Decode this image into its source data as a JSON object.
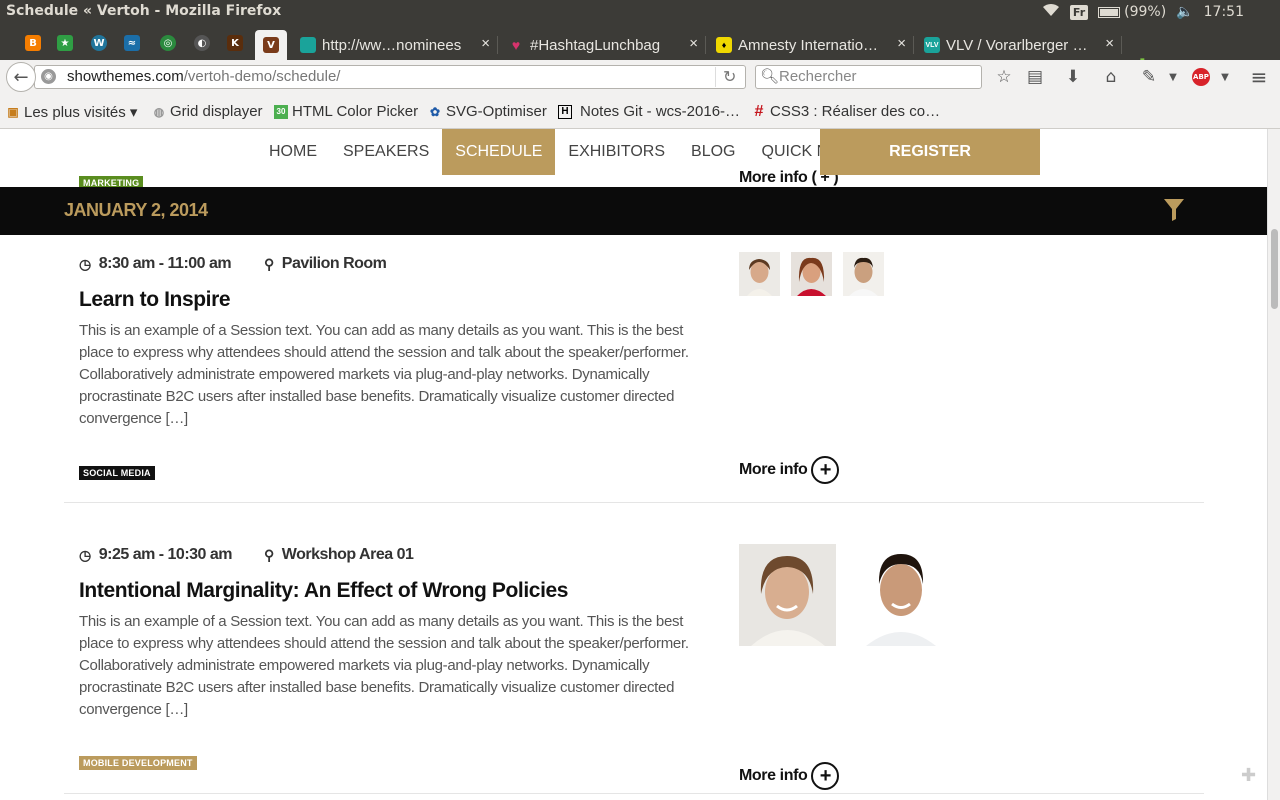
{
  "window": {
    "title": "Schedule « Vertoh - Mozilla Firefox",
    "keyboard_layout": "Fr",
    "battery": "(99%)",
    "clock": "17:51"
  },
  "tabs": {
    "pinned": [
      {
        "icon": "blogger-icon",
        "color": "#f57d00"
      },
      {
        "icon": "star-app-icon",
        "color": "#2f9e44"
      },
      {
        "icon": "wordpress-icon",
        "color": "#21759b"
      },
      {
        "icon": "waves-app-icon",
        "color": "#1b6ea8"
      },
      {
        "icon": "green-circle-icon",
        "color": "#2b8a3e"
      },
      {
        "icon": "globe-icon",
        "color": "#555555"
      },
      {
        "icon": "k-app-icon",
        "color": "#5a2d0c"
      },
      {
        "icon": "vertoh-icon",
        "color": "#7a3b1a"
      }
    ],
    "open": [
      {
        "label": "http://ww…nominees",
        "icon_color": "#1aa39a"
      },
      {
        "label": "#HashtagLunchbag",
        "icon_color": "#d6336c"
      },
      {
        "label": "Amnesty Internatio…",
        "icon_color": "#f0d800"
      },
      {
        "label": "VLV / Vorarlberger …",
        "icon_color": "#1aa39a"
      }
    ],
    "new_tab_symbol": "✚"
  },
  "navbar": {
    "url_host": "showthemes.com",
    "url_path": "/vertoh-demo/schedule/",
    "search_placeholder": "Rechercher"
  },
  "bookmarks": [
    {
      "label": "Les plus visités ▾",
      "icon": "folder-icon"
    },
    {
      "label": "Grid displayer",
      "icon": "globe-icon"
    },
    {
      "label": "HTML Color Picker",
      "icon": "color-picker-icon"
    },
    {
      "label": "SVG-Optimiser",
      "icon": "svg-icon"
    },
    {
      "label": "Notes Git - wcs-2016-…",
      "icon": "h-icon"
    },
    {
      "label": "CSS3 : Réaliser des co…",
      "icon": "hash-icon"
    }
  ],
  "site": {
    "nav": [
      "HOME",
      "SPEAKERS",
      "SCHEDULE",
      "EXHIBITORS",
      "BLOG",
      "QUICK NAV"
    ],
    "nav_active": "SCHEDULE",
    "register": "REGISTER",
    "accent_color": "#bb9b5d",
    "prev_tag": "MARKETING",
    "prev_more_info": "More info",
    "date": "JANUARY 2, 2014",
    "sessions": [
      {
        "time": "8:30 am - 11:00 am",
        "location": "Pavilion Room",
        "title": "Learn to Inspire",
        "description": "This is an example of a Session text. You can add as many details as you want. This is the best place to express why attendees should attend the session and talk about the speaker/performer. Collaboratively administrate empowered markets via plug-and-play networks. Dynamically procrastinate B2C users after installed base benefits. Dramatically visualize customer directed convergence […]",
        "tag": "SOCIAL MEDIA",
        "tag_color": "#111111",
        "more_info": "More info"
      },
      {
        "time": "9:25 am - 10:30 am",
        "location": "Workshop Area 01",
        "title": "Intentional Marginality: An Effect of Wrong Policies",
        "description": "This is an example of a Session text. You can add as many details as you want. This is the best place to express why attendees should attend the session and talk about the speaker/performer. Collaboratively administrate empowered markets via plug-and-play networks. Dynamically procrastinate B2C users after installed base benefits. Dramatically visualize customer directed convergence […]",
        "tag": "MOBILE DEVELOPMENT",
        "tag_color": "#bb9b5d",
        "more_info": "More info"
      }
    ]
  }
}
